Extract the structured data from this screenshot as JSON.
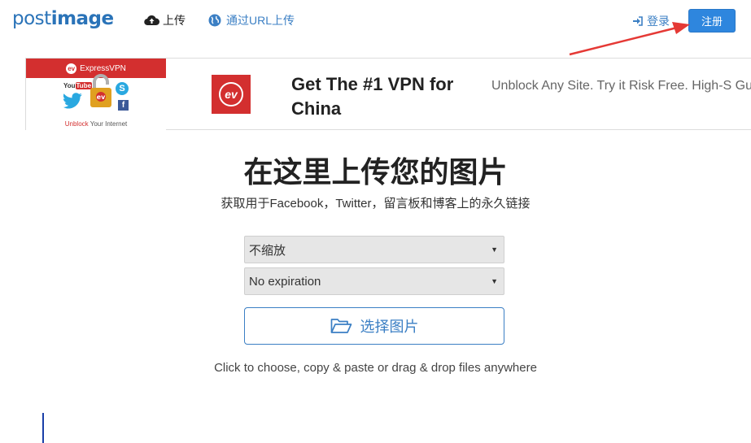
{
  "header": {
    "logo_text_light": "post",
    "logo_text_bold": "image",
    "nav_upload": "上传",
    "nav_url_upload": "通过URL上传",
    "login": "登录",
    "signup": "注册"
  },
  "ad": {
    "thumb_brand": "ExpressVPN",
    "thumb_youtube_a": "You",
    "thumb_youtube_b": "Tube",
    "thumb_tagline_red": "Unblock",
    "thumb_tagline_rest": " Your Internet",
    "headline": "Get The #1 VPN for China",
    "description": "Unblock Any Site. Try it Risk Free. High-S Guaranteed!"
  },
  "main": {
    "title": "在这里上传您的图片",
    "subtitle": "获取用于Facebook，Twitter，留言板和博客上的永久链接",
    "resize_select": "不缩放",
    "expiration_select": "No expiration",
    "choose_button": "选择图片",
    "hint": "Click to choose, copy & paste or drag & drop files anywhere"
  },
  "colors": {
    "brand_blue": "#2a73b8",
    "link_blue": "#3b7fc4",
    "signup_bg": "#2e86de",
    "annotation_arrow": "#e53935",
    "vpn_red": "#d32f2f"
  }
}
